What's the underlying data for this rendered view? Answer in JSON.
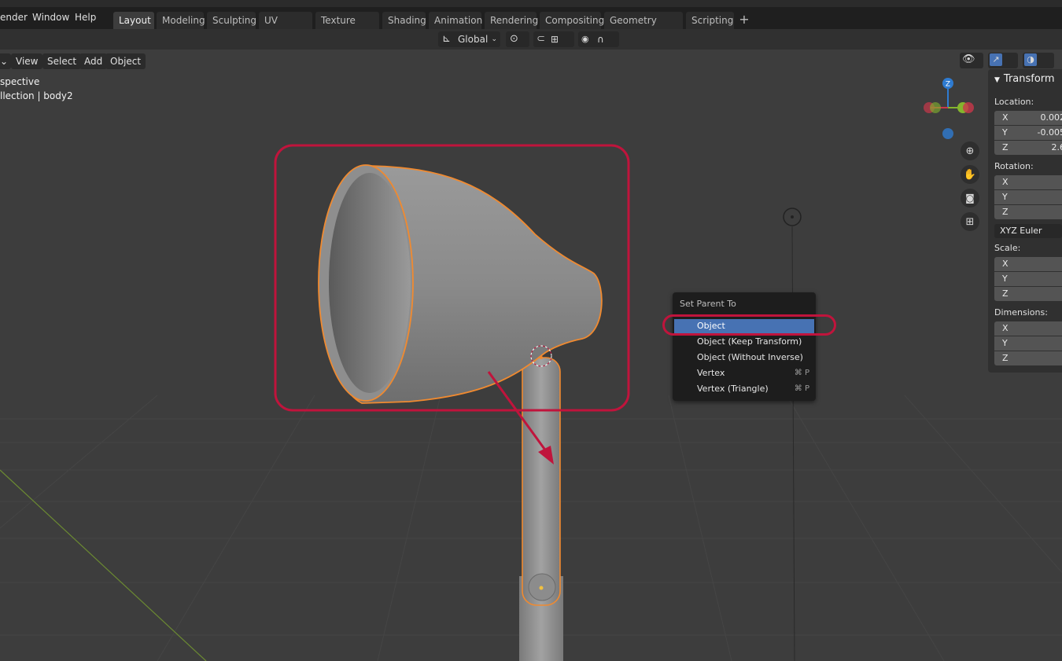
{
  "menus": [
    "ender",
    "Window",
    "Help"
  ],
  "workspace_tabs": [
    "Layout",
    "Modeling",
    "Sculpting",
    "UV Editing",
    "Texture Paint",
    "Shading",
    "Animation",
    "Rendering",
    "Compositing",
    "Geometry Nodes",
    "Scripting"
  ],
  "active_tab": "Layout",
  "header": {
    "transform_orientation": "Global"
  },
  "viewport_menu": [
    "View",
    "Select",
    "Add",
    "Object"
  ],
  "viewport_info": {
    "mode": "spective",
    "collection": "llection | body2"
  },
  "gizmo": {
    "z": "Z"
  },
  "transform_panel": {
    "title": "Transform",
    "location_label": "Location:",
    "location": [
      {
        "axis": "X",
        "value": "0.002"
      },
      {
        "axis": "Y",
        "value": "-0.005"
      },
      {
        "axis": "Z",
        "value": "2.6"
      }
    ],
    "rotation_label": "Rotation:",
    "rotation": [
      {
        "axis": "X"
      },
      {
        "axis": "Y"
      },
      {
        "axis": "Z"
      }
    ],
    "rotation_mode": "XYZ Euler",
    "scale_label": "Scale:",
    "scale": [
      {
        "axis": "X"
      },
      {
        "axis": "Y"
      },
      {
        "axis": "Z"
      }
    ],
    "dimensions_label": "Dimensions:",
    "dimensions": [
      {
        "axis": "X"
      },
      {
        "axis": "Y"
      },
      {
        "axis": "Z"
      }
    ]
  },
  "context_menu": {
    "title": "Set Parent To",
    "items": [
      {
        "label": "Object",
        "shortcut": "",
        "highlighted": true
      },
      {
        "label": "Object (Keep Transform)",
        "shortcut": ""
      },
      {
        "label": "Object (Without Inverse)",
        "shortcut": ""
      },
      {
        "label": "Vertex",
        "shortcut": "⌘ P"
      },
      {
        "label": "Vertex (Triangle)",
        "shortcut": "⌘ P"
      }
    ]
  },
  "colors": {
    "annotation": "#c0143c",
    "selection_outline": "#f08a30",
    "menu_highlight": "#4772b3",
    "axis_x": "#c9374a",
    "axis_y": "#84b52d",
    "axis_z": "#2e7bd1"
  }
}
